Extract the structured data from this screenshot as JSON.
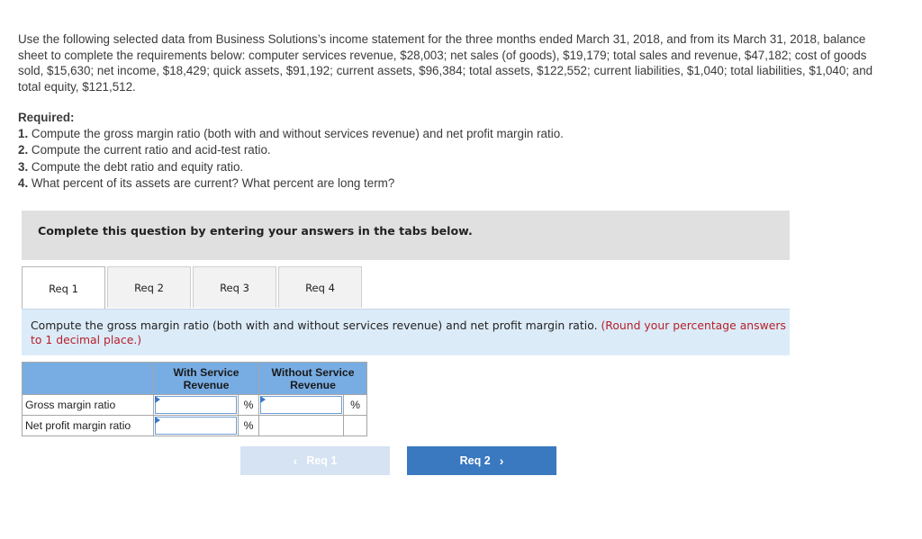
{
  "intro": {
    "text": "Use the following selected data from Business Solutions’s income statement for the three months ended March 31, 2018, and from its March 31, 2018, balance sheet to complete the requirements below: computer services revenue, $28,003; net sales (of goods), $19,179; total sales and revenue, $47,182; cost of goods sold, $15,630; net income, $18,429; quick assets, $91,192; current assets, $96,384; total assets, $122,552; current liabilities, $1,040; total liabilities, $1,040; and total equity, $121,512."
  },
  "required": {
    "title": "Required:",
    "items": [
      {
        "num": "1.",
        "text": " Compute the gross margin ratio (both with and without services revenue) and net profit margin ratio."
      },
      {
        "num": "2.",
        "text": " Compute the current ratio and acid-test ratio."
      },
      {
        "num": "3.",
        "text": " Compute the debt ratio and equity ratio."
      },
      {
        "num": "4.",
        "text": " What percent of its assets are current? What percent are long term?"
      }
    ]
  },
  "banner": {
    "text": "Complete this question by entering your answers in the tabs below."
  },
  "tabs": [
    {
      "label": "Req 1",
      "active": true
    },
    {
      "label": "Req 2",
      "active": false
    },
    {
      "label": "Req 3",
      "active": false
    },
    {
      "label": "Req 4",
      "active": false
    }
  ],
  "instruction": {
    "text": "Compute the gross margin ratio (both with and without services revenue) and net profit margin ratio. ",
    "note": "(Round your percentage answers to 1 decimal place.)"
  },
  "table": {
    "headers": [
      "",
      "With Service Revenue",
      "Without Service Revenue"
    ],
    "unit": "%",
    "rows": [
      {
        "label": "Gross margin ratio",
        "with_value": "",
        "without_value": ""
      },
      {
        "label": "Net profit margin ratio",
        "with_value": ""
      }
    ]
  },
  "nav": {
    "prev_label": "Req 1",
    "next_label": "Req 2",
    "prev_icon": "chevron-left-icon",
    "next_icon": "chevron-right-icon"
  },
  "colors": {
    "accent": "#3a78c0",
    "table_header": "#78ade4",
    "instruction_bg": "#dcebf8",
    "note_red": "#b5202a",
    "banner_bg": "#e0e0e0"
  }
}
